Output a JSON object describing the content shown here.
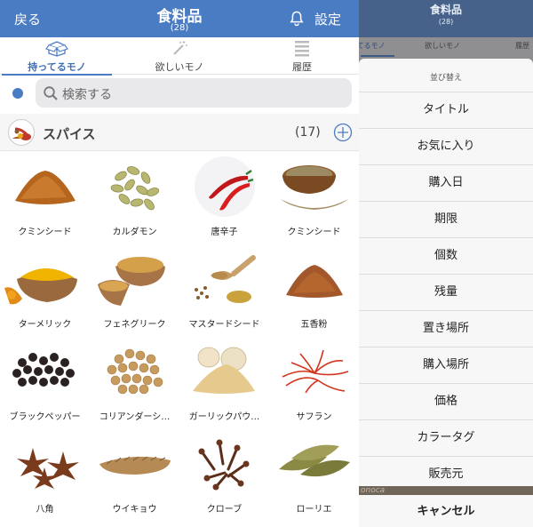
{
  "left": {
    "nav": {
      "back": "戻る",
      "title": "食料品",
      "count": "(28)",
      "settings": "設定"
    },
    "tabs": [
      {
        "label": "持ってるモノ",
        "icon": "box-icon"
      },
      {
        "label": "欲しいモノ",
        "icon": "magic-wand-icon"
      },
      {
        "label": "履歴",
        "icon": "list-icon"
      }
    ],
    "search": {
      "placeholder": "検索する"
    },
    "section": {
      "title": "スパイス",
      "count": "(17)"
    },
    "items": [
      {
        "label": "クミンシード",
        "image": "spice-powder"
      },
      {
        "label": "カルダモン",
        "image": "cardamom-pods"
      },
      {
        "label": "唐辛子",
        "image": "red-chili"
      },
      {
        "label": "クミンシード",
        "image": "cumin-bowl"
      },
      {
        "label": "ターメリック",
        "image": "turmeric"
      },
      {
        "label": "フェネグリーク",
        "image": "fenugreek"
      },
      {
        "label": "マスタードシード",
        "image": "mustard"
      },
      {
        "label": "五香粉",
        "image": "five-spice"
      },
      {
        "label": "ブラックペッパー",
        "image": "black-pepper"
      },
      {
        "label": "コリアンダーシ…",
        "image": "coriander"
      },
      {
        "label": "ガーリックパウ…",
        "image": "garlic-powder"
      },
      {
        "label": "サフラン",
        "image": "saffron"
      },
      {
        "label": "八角",
        "image": "star-anise"
      },
      {
        "label": "ウイキョウ",
        "image": "fennel"
      },
      {
        "label": "クローブ",
        "image": "clove"
      },
      {
        "label": "ローリエ",
        "image": "bay-leaf"
      }
    ]
  },
  "right": {
    "nav": {
      "title": "食料品",
      "count": "(28)"
    },
    "tabs": [
      "持ってるモノ",
      "欲しいモノ",
      "履歴"
    ],
    "sheet": {
      "header": "並び替え",
      "options": [
        "タイトル",
        "お気に入り",
        "購入日",
        "期限",
        "個数",
        "残量",
        "置き場所",
        "購入場所",
        "価格",
        "カラータグ",
        "販売元"
      ],
      "cancel": "キャンセル"
    },
    "strip_text": "onoca"
  },
  "colors": {
    "accent": "#4a7cc4",
    "dimmed_nav": "#46628a",
    "overlay": "#8e8e90"
  }
}
